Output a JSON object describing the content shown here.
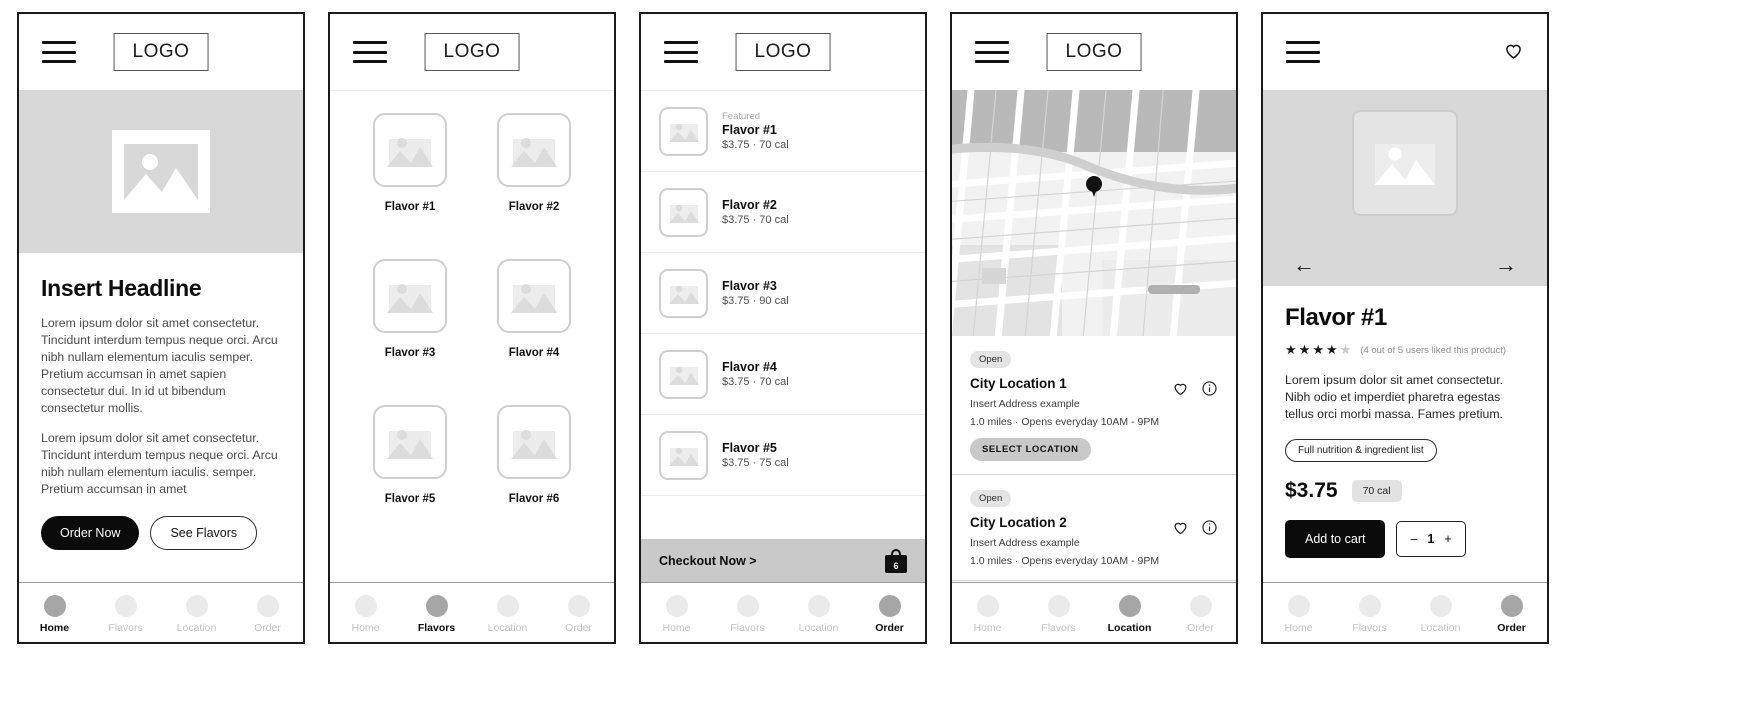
{
  "common": {
    "logo": "LOGO",
    "menu_icon": "hamburger-menu-icon",
    "nav": [
      {
        "label": "Home"
      },
      {
        "label": "Flavors"
      },
      {
        "label": "Location"
      },
      {
        "label": "Order"
      }
    ]
  },
  "screen_home": {
    "headline": "Insert Headline",
    "paragraph1": "Lorem ipsum dolor sit amet consectetur. Tincidunt interdum tempus neque orci. Arcu nibh nullam elementum iaculis semper. Pretium accumsan in amet sapien consectetur dui. In id ut bibendum consectetur mollis.",
    "paragraph2": "Lorem ipsum dolor sit amet consectetur. Tincidunt interdum tempus neque orci. Arcu nibh nullam elementum iaculis. semper. Pretium accumsan in amet",
    "primary_button": "Order Now",
    "secondary_button": "See Flavors",
    "active_nav": "Home"
  },
  "screen_flavors": {
    "active_nav": "Flavors",
    "tiles": [
      {
        "label": "Flavor #1"
      },
      {
        "label": "Flavor #2"
      },
      {
        "label": "Flavor #3"
      },
      {
        "label": "Flavor #4"
      },
      {
        "label": "Flavor #5"
      },
      {
        "label": "Flavor #6"
      }
    ]
  },
  "screen_order": {
    "active_nav": "Order",
    "items": [
      {
        "eyebrow": "Featured",
        "name": "Flavor #1",
        "sub": "$3.75 · 70 cal"
      },
      {
        "eyebrow": "",
        "name": "Flavor #2",
        "sub": "$3.75 · 70 cal"
      },
      {
        "eyebrow": "",
        "name": "Flavor #3",
        "sub": "$3.75 · 90 cal"
      },
      {
        "eyebrow": "",
        "name": "Flavor #4",
        "sub": "$3.75 · 70 cal"
      },
      {
        "eyebrow": "",
        "name": "Flavor #5",
        "sub": "$3.75 · 75 cal"
      }
    ],
    "checkout_label": "Checkout Now >",
    "cart_count": "6"
  },
  "screen_location": {
    "active_nav": "Location",
    "locations": [
      {
        "status": "Open",
        "name": "City Location 1",
        "address": "Insert Address example",
        "hours": "1.0 miles · Opens everyday 10AM - 9PM",
        "select_button": "SELECT LOCATION"
      },
      {
        "status": "Open",
        "name": "City Location 2",
        "address": "Insert Address example",
        "hours": "1.0 miles · Opens everyday 10AM - 9PM",
        "select_button": ""
      }
    ]
  },
  "screen_detail": {
    "active_nav": "Order",
    "product_name": "Flavor #1",
    "rating_filled": 4,
    "rating_total": 5,
    "rating_text": "(4 out of 5 users liked this product)",
    "description": "Lorem ipsum dolor sit amet consectetur. Nibh odio et imperdiet pharetra egestas tellus orci morbi massa. Fames pretium.",
    "nutrition_pill": "Full nutrition & ingredient list",
    "price": "$3.75",
    "calories": "70 cal",
    "add_to_cart": "Add to cart",
    "qty_minus": "–",
    "qty_value": "1",
    "qty_plus": "+",
    "prev_arrow": "←",
    "next_arrow": "→",
    "favorite_icon": "heart-icon"
  },
  "colors": {
    "ink": "#0b0b0b",
    "muted": "#9a9a9a",
    "placeholder_gray": "#d8d8d8",
    "bar_gray": "#c9c9c9"
  }
}
